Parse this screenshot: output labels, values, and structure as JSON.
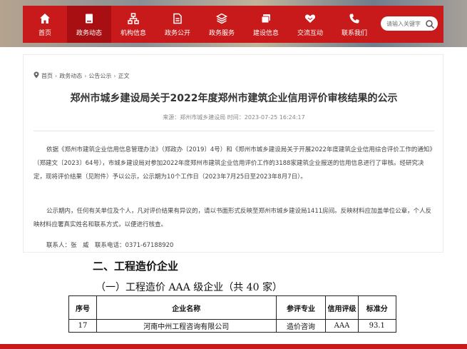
{
  "nav": {
    "items": [
      {
        "label": "首页",
        "icon": "home-icon",
        "active": false
      },
      {
        "label": "政务动态",
        "icon": "document-icon",
        "active": true
      },
      {
        "label": "机构信息",
        "icon": "org-chart-icon",
        "active": false
      },
      {
        "label": "政务公开",
        "icon": "file-icon",
        "active": false
      },
      {
        "label": "政务服务",
        "icon": "layers-icon",
        "active": false
      },
      {
        "label": "建设信息",
        "icon": "folder-icon",
        "active": false
      },
      {
        "label": "交流互动",
        "icon": "handshake-icon",
        "active": false
      },
      {
        "label": "联系我们",
        "icon": "phone-icon",
        "active": false
      }
    ],
    "search_placeholder": "请输入关键字"
  },
  "breadcrumb": [
    "首页",
    "政务动态",
    "公告公示",
    "正文"
  ],
  "article": {
    "title": "郑州市城乡建设局关于2022年度郑州市建筑企业信用评价审核结果的公示",
    "meta": "来源：郑州市城乡建设局  时间：2023-07-25 16:24:17",
    "paragraph1": "依据《郑州市建筑企业信用信息管理办法》（郑政办〔2019〕4号）和《郑州市城乡建设局关于开展2022年度建筑企业信用综合评价工作的通知》（郑建文〔2023〕64号），市城乡建设局对参加2022年度郑州市建筑企业信用评价工作的3188家建筑企业报送的信用信息进行了审核。经研究决定，现将评价结果（见附件）予以公示，公示期为10个工作日（2023年7月25日至2023年8月7日）。",
    "paragraph2": "公示期内，任何有关单位及个人，凡对评价结果有异议的，请以书面形式反映至郑州市城乡建设局1411房间。反映材料应加盖单位公章，个人反映材料应署真实姓名和联系方式，以便进行核查。",
    "contact": "联系人：张　威　联系电话：0371-67188920"
  },
  "doc": {
    "heading": "二、工程造价企业",
    "subheading": "（一）工程造价 AAA 级企业（共 40 家）",
    "columns": [
      "序号",
      "企业名称",
      "参评专业",
      "信用评级",
      "标准分"
    ],
    "rows": [
      [
        "17",
        "河南中州工程咨询有限公司",
        "造价咨询",
        "AAA",
        "93.1"
      ]
    ]
  },
  "colors": {
    "brand_red": "#c81a1b",
    "active_red": "#a80f12"
  }
}
